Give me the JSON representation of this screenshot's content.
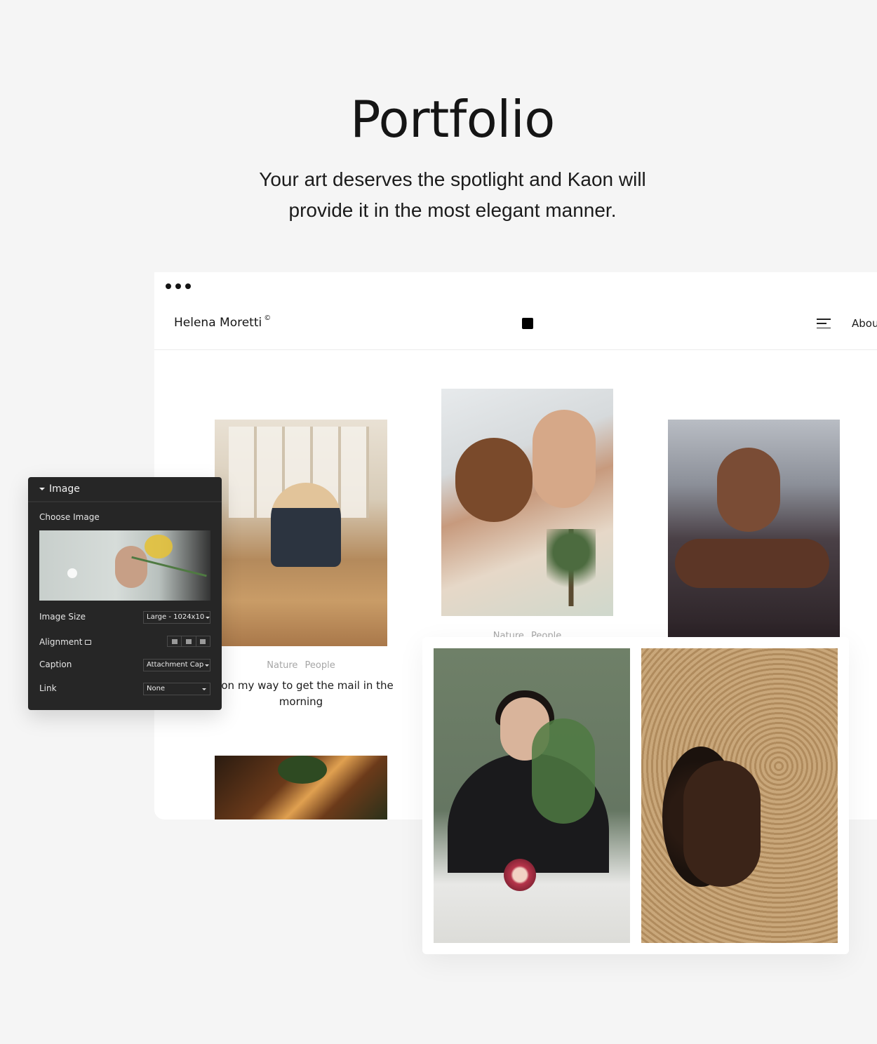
{
  "hero": {
    "title": "Portfolio",
    "subtitle": "Your art deserves the spotlight and Kaon will provide it in the most elegant manner."
  },
  "browser": {
    "window_controls": [
      "dot",
      "dot",
      "dot"
    ],
    "header": {
      "brand": "Helena Moretti",
      "brand_mark": "©",
      "logo_icon": "square-logo-icon",
      "menu_icon": "hamburger-menu-icon",
      "nav_link": "Abou"
    },
    "gallery": [
      {
        "tags": "Nature People",
        "title": "le on my way to get the mail in the morning"
      },
      {
        "tags": "Nature People"
      },
      {},
      {}
    ]
  },
  "card": {
    "images": [
      "woman-with-protea-flowers",
      "woman-in-straw-hat"
    ]
  },
  "panel": {
    "title": "Image",
    "choose_image_label": "Choose Image",
    "image_size_label": "Image Size",
    "image_size_value": "Large - 1024x10",
    "alignment_label": "Alignment",
    "alignment_options": [
      "left",
      "center",
      "right"
    ],
    "caption_label": "Caption",
    "caption_value": "Attachment Cap",
    "link_label": "Link",
    "link_value": "None"
  }
}
